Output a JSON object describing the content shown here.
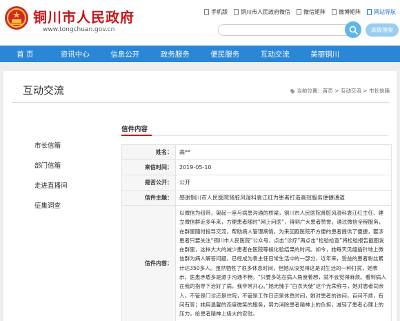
{
  "site": {
    "title": "铜川市人民政府",
    "url": "www.tongchuan.gov.cn",
    "emblem_icon": "national-emblem-icon"
  },
  "quick_links": [
    {
      "label": "手机版",
      "icon": "phone-icon",
      "active": false
    },
    {
      "label": "铜川市人民政府微信",
      "icon": "wechat-icon",
      "active": false
    },
    {
      "label": "微信矩阵",
      "icon": "wechat-matrix-icon",
      "active": false
    },
    {
      "label": "微博矩阵",
      "icon": "weibo-matrix-icon",
      "active": false
    },
    {
      "label": "网站导航",
      "icon": "sitemap-icon",
      "active": true
    }
  ],
  "search": {
    "placeholder": "",
    "button_icon": "search-icon",
    "advanced_label": "高级搜索"
  },
  "nav": [
    "首 页",
    "资讯中心",
    "信息公开",
    "政务服务",
    "便民服务",
    "互动交流",
    "美丽铜川"
  ],
  "page": {
    "section_title": "互动交流",
    "breadcrumb": "当前位置：首页 > 互动交流 > 市长信箱"
  },
  "sidebar": [
    "市长信箱",
    "部门信箱",
    "走进直播间",
    "征集调查"
  ],
  "letter": {
    "heading": "信件内容",
    "rows": [
      {
        "key": "姓名：",
        "value": "高**"
      },
      {
        "key": "来信时间：",
        "value": "2019-05-10"
      },
      {
        "key": "是否公开：",
        "value": "公开"
      },
      {
        "key": "信件主题：",
        "value": "感谢铜川市人民医院肾脏风湿科袁江红为患者打造高效服务便捷通道"
      }
    ],
    "content_label": "信件内容：",
    "content": "以微信为纽带，架起一座与病患沟通的桥梁，铜川市人民医院肾脏风湿科袁江红主任、建立微信群近多年来，方便患者随时“网上问医”，得到广大患者赞誉。通过微信全程服务，在群里随时指导交流，帮助病人管理病情，为来回跑医院不方便的患者提供了便捷，娶涉患者只要关注“铜川市人民医院”公众号，点击“诊疗”再点击“检验检查”将检验报告截图发在群里，这样大大的减少患者在医院等候化验结果的时间。如今，她每天见缝插针地上微信群为病人解答问题，已经成为袁主任日常生活中的一部分，近年来，受益的患者粉丝累计达350多人。虽然牺牲了很多休息时间，但她从没觉得这是对生活的一种打扰，她表示，医患矛盾多是源于沟通不畅，“只要多站在病人角度着想，就不会觉得麻烦。看到病人在我的指导下治好了病，我非常开心。”她无愧于“白衣天使”这个光荣称号，她对患者同亲人，不管是门诊还是住院，不管是工作日还是休息时间，她对患者的询问，百问不烦，有问有答；她用温馨的态度微笑的服务，努力消除患者精神上的负担，减轻了患者心理上的压力，给患者精神上极大的安慰。"
  },
  "colors": {
    "brand_red": "#c8161d",
    "nav_blue": "#2a86d7",
    "search_blue": "#60b5e8"
  }
}
